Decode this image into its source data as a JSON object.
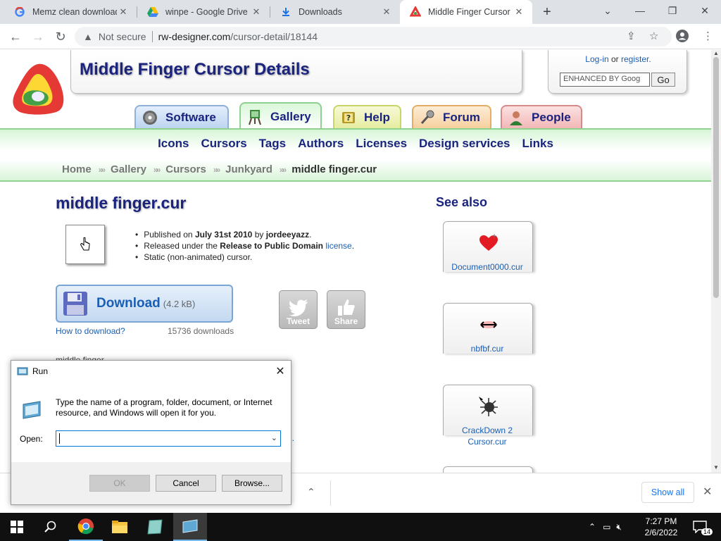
{
  "browser": {
    "tabs": [
      {
        "title": "Memz clean download",
        "favicon": "google-g-icon"
      },
      {
        "title": "winpe - Google Drive",
        "favicon": "google-drive-icon"
      },
      {
        "title": "Downloads",
        "favicon": "download-icon"
      },
      {
        "title": "Middle Finger Cursor",
        "favicon": "rw-designer-icon",
        "active": true
      }
    ],
    "security_label": "Not secure",
    "url_host": "rw-designer.com",
    "url_path": "/cursor-detail/18144"
  },
  "site": {
    "title": "Middle Finger Cursor Details",
    "login": "Log-in",
    "or": "or",
    "register": "register.",
    "search_placeholder": "ENHANCED BY Goog",
    "go_label": "Go",
    "nav_tabs": [
      "Software",
      "Gallery",
      "Help",
      "Forum",
      "People"
    ],
    "menu": [
      "Icons",
      "Cursors",
      "Tags",
      "Authors",
      "Licenses",
      "Design services",
      "Links"
    ],
    "breadcrumbs": [
      "Home",
      "Gallery",
      "Cursors",
      "Junkyard"
    ],
    "breadcrumb_current": "middle finger.cur",
    "breadcrumb_sep": "»»"
  },
  "cursor": {
    "name": "middle finger.cur",
    "published_prefix": "Published on",
    "published_date": "July 31st 2010",
    "by": "by",
    "author": "jordeeyazz",
    "released_prefix": "Released under the",
    "license_name": "Release to Public Domain",
    "license_link": "license",
    "static_note": "Static (non-animated) cursor.",
    "download_label": "Download",
    "download_size": "(4.2 kB)",
    "how_to": "How to download?",
    "downloads_count": "15736 downloads",
    "tweet": "Tweet",
    "share": "Share",
    "partial_text": "middle finger",
    "partial_link": "l."
  },
  "see_also": {
    "title": "See also",
    "items": [
      {
        "name": "Document0000.cur",
        "icon": "heart-cursor-icon"
      },
      {
        "name": "nbfbf.cur",
        "icon": "red-arrow-cursor-icon"
      },
      {
        "name": "CrackDown 2 Cursor.cur",
        "icon": "spider-cursor-icon"
      }
    ]
  },
  "shelf": {
    "show_all": "Show all"
  },
  "run_dialog": {
    "title": "Run",
    "description": "Type the name of a program, folder, document, or Internet resource, and Windows will open it for you.",
    "open_label": "Open:",
    "open_value": "",
    "ok": "OK",
    "cancel": "Cancel",
    "browse": "Browse..."
  },
  "taskbar": {
    "time": "7:27 PM",
    "date": "2/6/2022",
    "notifications": "14"
  }
}
